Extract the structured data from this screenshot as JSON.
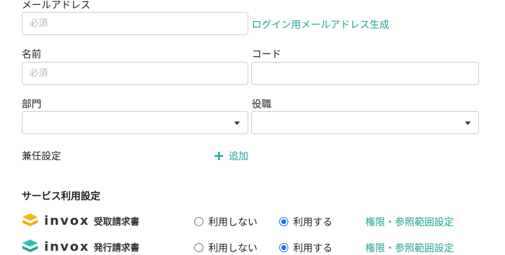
{
  "fields": {
    "email": {
      "label": "メールアドレス",
      "placeholder": "必須",
      "value": ""
    },
    "email_generate_link": "ログイン用メールアドレス生成",
    "name": {
      "label": "名前",
      "placeholder": "必須",
      "value": ""
    },
    "code": {
      "label": "コード",
      "placeholder": "",
      "value": ""
    },
    "department": {
      "label": "部門",
      "selected": ""
    },
    "position": {
      "label": "役職",
      "selected": ""
    },
    "concurrent": {
      "label": "兼任設定",
      "add_label": "追加"
    }
  },
  "service_settings": {
    "title": "サービス利用設定",
    "services": [
      {
        "brand": "invox",
        "name": "受取請求書",
        "options": [
          "利用しない",
          "利用する"
        ],
        "selected": "利用する",
        "scope_link": "権限・参照範囲設定",
        "icon": "invox-receive-logo-icon",
        "color": "#f5b800"
      },
      {
        "brand": "invox",
        "name": "発行請求書",
        "options": [
          "利用しない",
          "利用する"
        ],
        "selected": "利用する",
        "scope_link": "権限・参照範囲設定",
        "icon": "invox-issue-logo-icon",
        "color": "#2bbfae"
      }
    ]
  },
  "colors": {
    "accent": "#1fa596",
    "radio_selected": "#1a73e8"
  }
}
